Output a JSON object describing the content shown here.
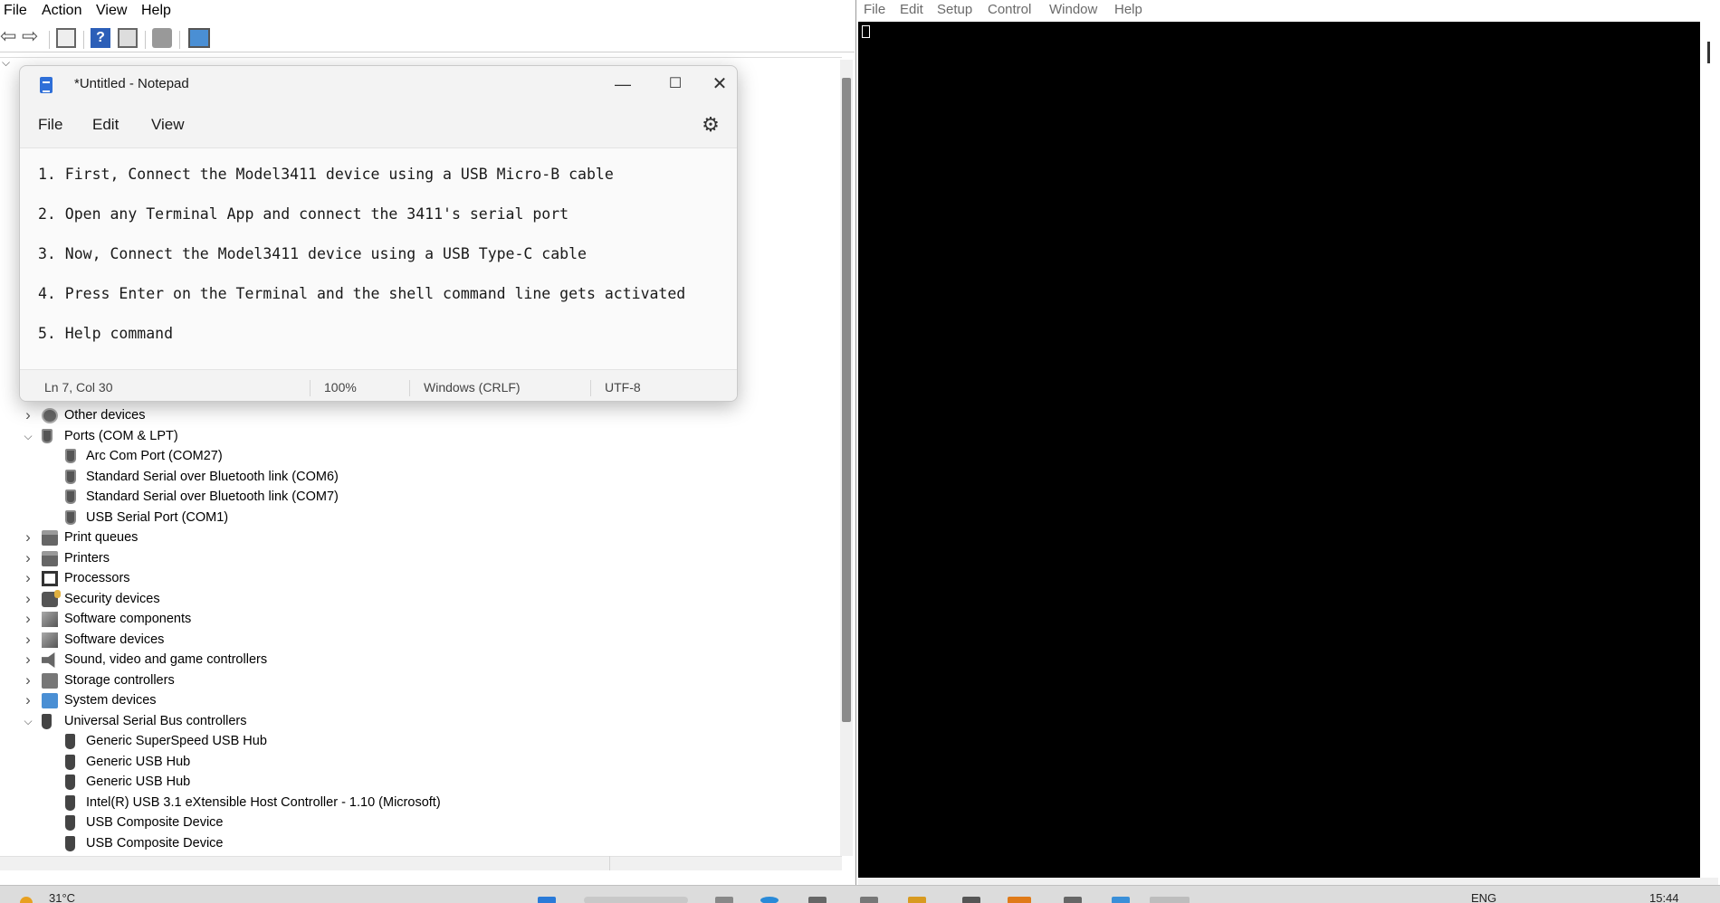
{
  "device_manager": {
    "menu": [
      "File",
      "Action",
      "View",
      "Help"
    ],
    "tree": [
      {
        "label": "Other devices",
        "expanded": false,
        "level": 0,
        "icon": "other-devices-icon"
      },
      {
        "label": "Ports (COM & LPT)",
        "expanded": true,
        "level": 0,
        "icon": "port-icon"
      },
      {
        "label": "Arc Com Port (COM27)",
        "level": 1,
        "icon": "port-icon"
      },
      {
        "label": "Standard Serial over Bluetooth link (COM6)",
        "level": 1,
        "icon": "port-icon"
      },
      {
        "label": "Standard Serial over Bluetooth link (COM7)",
        "level": 1,
        "icon": "port-icon"
      },
      {
        "label": "USB Serial Port (COM1)",
        "level": 1,
        "icon": "port-icon"
      },
      {
        "label": "Print queues",
        "expanded": false,
        "level": 0,
        "icon": "printer-icon"
      },
      {
        "label": "Printers",
        "expanded": false,
        "level": 0,
        "icon": "printer-icon"
      },
      {
        "label": "Processors",
        "expanded": false,
        "level": 0,
        "icon": "processor-icon"
      },
      {
        "label": "Security devices",
        "expanded": false,
        "level": 0,
        "icon": "security-icon"
      },
      {
        "label": "Software components",
        "expanded": false,
        "level": 0,
        "icon": "software-icon"
      },
      {
        "label": "Software devices",
        "expanded": false,
        "level": 0,
        "icon": "software-icon"
      },
      {
        "label": "Sound, video and game controllers",
        "expanded": false,
        "level": 0,
        "icon": "sound-icon"
      },
      {
        "label": "Storage controllers",
        "expanded": false,
        "level": 0,
        "icon": "storage-icon"
      },
      {
        "label": "System devices",
        "expanded": false,
        "level": 0,
        "icon": "system-icon"
      },
      {
        "label": "Universal Serial Bus controllers",
        "expanded": true,
        "level": 0,
        "icon": "usb-icon"
      },
      {
        "label": "Generic SuperSpeed USB Hub",
        "level": 1,
        "icon": "usb-icon"
      },
      {
        "label": "Generic USB Hub",
        "level": 1,
        "icon": "usb-icon"
      },
      {
        "label": "Generic USB Hub",
        "level": 1,
        "icon": "usb-icon"
      },
      {
        "label": "Intel(R) USB 3.1 eXtensible Host Controller - 1.10 (Microsoft)",
        "level": 1,
        "icon": "usb-icon"
      },
      {
        "label": "USB Composite Device",
        "level": 1,
        "icon": "usb-icon"
      },
      {
        "label": "USB Composite Device",
        "level": 1,
        "icon": "usb-icon"
      }
    ]
  },
  "notepad": {
    "title": "*Untitled - Notepad",
    "menu": [
      "File",
      "Edit",
      "View"
    ],
    "lines": [
      "1. First, Connect the Model3411 device using a USB Micro-B cable",
      "2. Open any Terminal App and connect the 3411's serial port",
      "3. Now, Connect the Model3411 device using a USB Type-C cable",
      "4. Press Enter on the Terminal and the shell command line gets activated",
      "5. Help command"
    ],
    "status": {
      "position": "Ln 7, Col 30",
      "zoom": "100%",
      "line_ending": "Windows (CRLF)",
      "encoding": "UTF-8"
    }
  },
  "terminal": {
    "menu": [
      "File",
      "Edit",
      "Setup",
      "Control",
      "Window",
      "Help"
    ],
    "background": "#000000"
  },
  "taskbar": {
    "weather": "31°C",
    "language": "ENG",
    "clock": "15:44"
  }
}
